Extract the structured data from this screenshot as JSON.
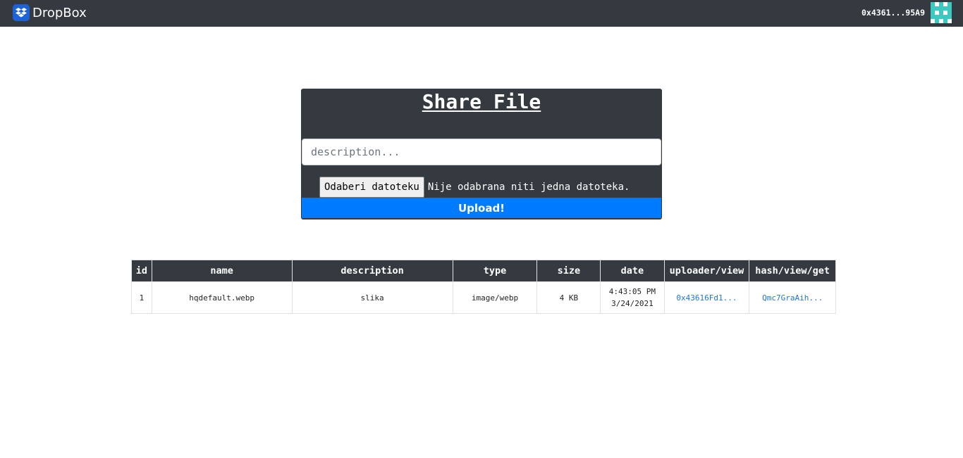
{
  "navbar": {
    "brand": "DropBox",
    "account": "0x4361...95A9",
    "logo_icon": "dropbox-logo-icon",
    "avatar_icon": "identicon-avatar"
  },
  "share": {
    "title": "Share File",
    "description_placeholder": "description...",
    "file_button": "Odaberi datoteku",
    "file_status": "Nije odabrana niti jedna datoteka.",
    "upload_label": "Upload!"
  },
  "table": {
    "headers": [
      "id",
      "name",
      "description",
      "type",
      "size",
      "date",
      "uploader/view",
      "hash/view/get"
    ],
    "rows": [
      {
        "id": "1",
        "name": "hqdefault.webp",
        "description": "slika",
        "type": "image/webp",
        "size": "4 KB",
        "time": "4:43:05 PM",
        "date": "3/24/2021",
        "uploader": "0x43616Fd1...",
        "hash": "Qmc7GraAih..."
      }
    ]
  },
  "colors": {
    "navbar": "#343a40",
    "primary": "#007bff",
    "link": "#1e74d8",
    "identicon": "#3cc9c0"
  }
}
